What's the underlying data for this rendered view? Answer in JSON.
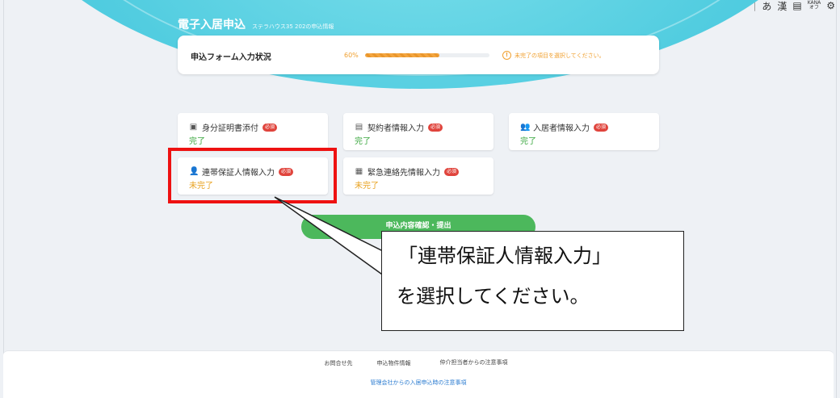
{
  "header": {
    "title": "電子入居申込",
    "subtitle": "ステラハウス35 202の申込情報"
  },
  "status_bar": {
    "ime": "あ",
    "icons": [
      "ime-kanji-icon",
      "dictionary-icon",
      "input-mode-icon",
      "gear-icon"
    ],
    "mini_label_top": "KANA",
    "mini_label_bottom": "オフ"
  },
  "progress": {
    "label": "申込フォーム入力状況",
    "percent_text": "60%",
    "percent": 60,
    "warning": "未完了の項目を選択してください。"
  },
  "forms": [
    {
      "label": "身分証明書添付",
      "badge": "必須",
      "status": "完了",
      "icon": "id-card-icon"
    },
    {
      "label": "契約者情報入力",
      "badge": "必須",
      "status": "完了",
      "icon": "document-icon"
    },
    {
      "label": "入居者情報入力",
      "badge": "必須",
      "status": "完了",
      "icon": "users-icon"
    },
    {
      "label": "連帯保証人情報入力",
      "badge": "必須",
      "status": "未完了",
      "icon": "user-icon"
    },
    {
      "label": "緊急連絡先情報入力",
      "badge": "必須",
      "status": "未完了",
      "icon": "contact-icon"
    }
  ],
  "submit_label": "申込内容確認・提出",
  "callout": {
    "line1": "「連帯保証人情報入力」",
    "line2": "を選択してください。"
  },
  "footer": {
    "links": [
      "お問合せ先",
      "申込物件情報",
      "仲介担当者からの注意事項"
    ],
    "bottom": "管理会社からの入居申込時の注意事項"
  },
  "colors": {
    "accent": "#4fcbe0",
    "done": "#3aa73e",
    "pending": "#e8a11e",
    "badge": "#e0443c",
    "submit": "#4cb85c",
    "highlight": "#ee1111"
  }
}
